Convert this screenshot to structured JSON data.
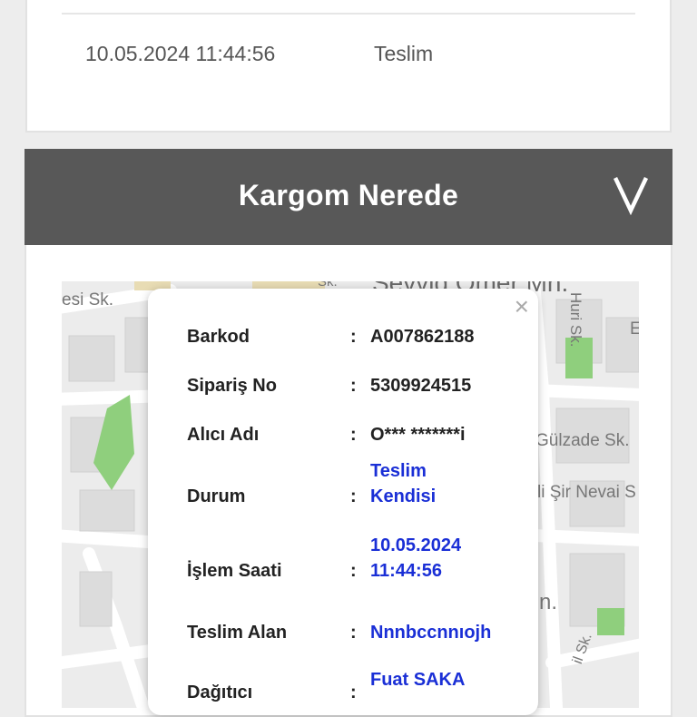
{
  "history": {
    "date": "10.05.2024 11:44:56",
    "status": "Teslim"
  },
  "header": {
    "title": "Kargom Nerede",
    "toggle_icon": "chevron-down-icon"
  },
  "map": {
    "labels": [
      "Sevvid Ömer Mh.",
      "Huri Sk.",
      "esi Sk.",
      "Sk.",
      "Gülzade Sk.",
      "li Şir Nevai S",
      "n.",
      "il Sk.",
      "E"
    ]
  },
  "popup": {
    "close_icon": "close-icon",
    "rows": [
      {
        "label": "Barkod",
        "colon": ":",
        "value": "A007862188"
      },
      {
        "label": "Sipariş No",
        "colon": ":",
        "value": "5309924515"
      },
      {
        "label": "Alıcı Adı",
        "colon": ":",
        "value": "O*** *******i"
      },
      {
        "label": "Durum",
        "colon": ":",
        "value_line1": "Teslim",
        "value_line2": "Kendisi"
      },
      {
        "label": "İşlem Saati",
        "colon": ":",
        "value_line1": "10.05.2024",
        "value_line2": "11:44:56"
      },
      {
        "label": "Teslim Alan",
        "colon": ":",
        "value": "Nnnbccnnıojh"
      },
      {
        "label": "Dağıtıcı",
        "colon": ":",
        "value": "Fuat SAKA"
      }
    ]
  },
  "colors": {
    "header_bg": "#585858",
    "link_blue": "#1a2fd6",
    "park_green": "#8fcf7d"
  }
}
